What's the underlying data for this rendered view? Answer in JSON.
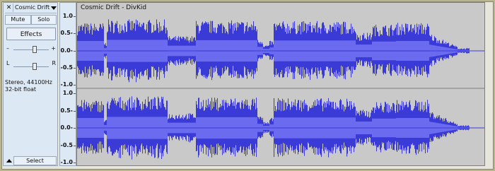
{
  "track": {
    "close_label": "✕",
    "name": "Cosmic Drift",
    "mute_label": "Mute",
    "solo_label": "Solo",
    "effects_label": "Effects",
    "gain_minus": "–",
    "gain_plus": "+",
    "gain_level": 0.6,
    "pan_left": "L",
    "pan_right": "R",
    "pan_level": 0.6,
    "format_line1": "Stereo, 44100Hz",
    "format_line2": "32-bit float",
    "select_label": "Select"
  },
  "clip": {
    "title": "Cosmic Drift - DivKid"
  },
  "ruler": {
    "labels": [
      "1.0",
      "0.5-",
      "0.0-",
      "-0.5",
      "-1.0"
    ]
  },
  "colors": {
    "wave": "#3a3ad6",
    "wave_rms": "#6b6bf0",
    "wave_bg": "#c9c9c9",
    "panel": "#dde8f5"
  }
}
